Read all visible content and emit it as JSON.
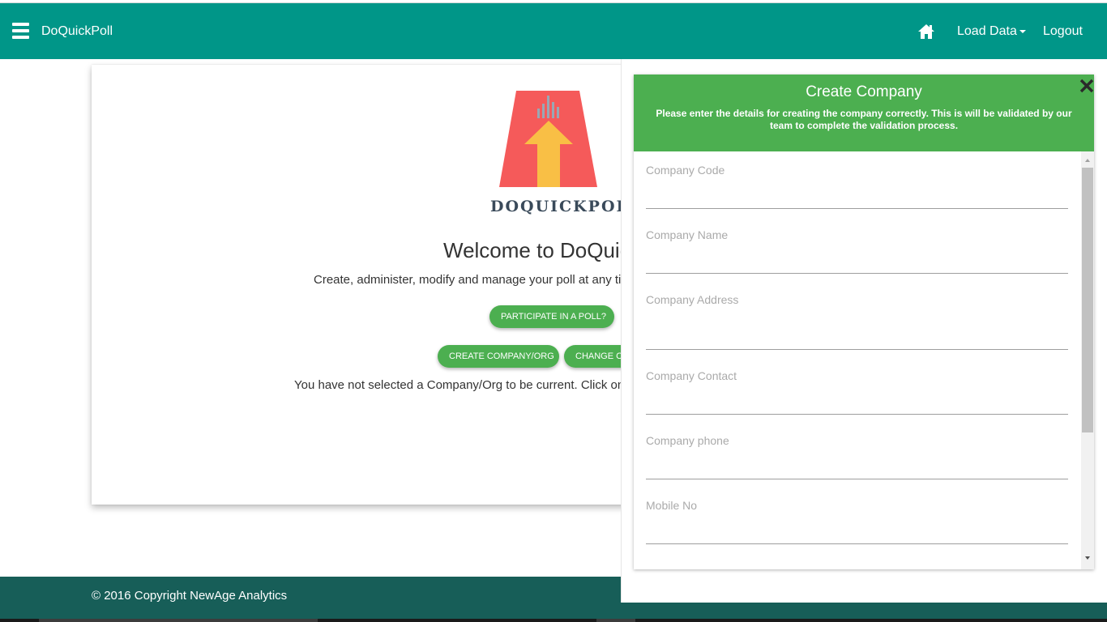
{
  "navbar": {
    "brand": "DoQuickPoll",
    "home_icon": "home-icon",
    "load_data": "Load Data",
    "logout": "Logout",
    "bg_color": "#009688"
  },
  "main": {
    "logo_text": "DOQUICKPOLL",
    "welcome": "Welcome to DoQuick",
    "subtitle": "Create, administer, modify and manage your poll at any time",
    "participate_button": "PARTICIPATE IN A POLL?",
    "create_button": "CREATE COMPANY/ORG",
    "change_button": "CHANGE C",
    "notice": "You have not selected a Company/Org to be current. Click on C"
  },
  "footer": {
    "copyright": "© 2016 Copyright NewAge Analytics",
    "bg_color": "#175e58"
  },
  "modal": {
    "title": "Create Company",
    "description": "Please enter the details for creating the company correctly. This is will be validated by our team to complete the validation process.",
    "header_color": "#4caf50",
    "close_icon": "close-icon",
    "fields": [
      {
        "label": "Company Code",
        "value": ""
      },
      {
        "label": "Company Name",
        "value": ""
      },
      {
        "label": "Company Address",
        "value": ""
      },
      {
        "label": "Company Contact",
        "value": ""
      },
      {
        "label": "Company phone",
        "value": ""
      },
      {
        "label": "Mobile No",
        "value": ""
      }
    ]
  }
}
